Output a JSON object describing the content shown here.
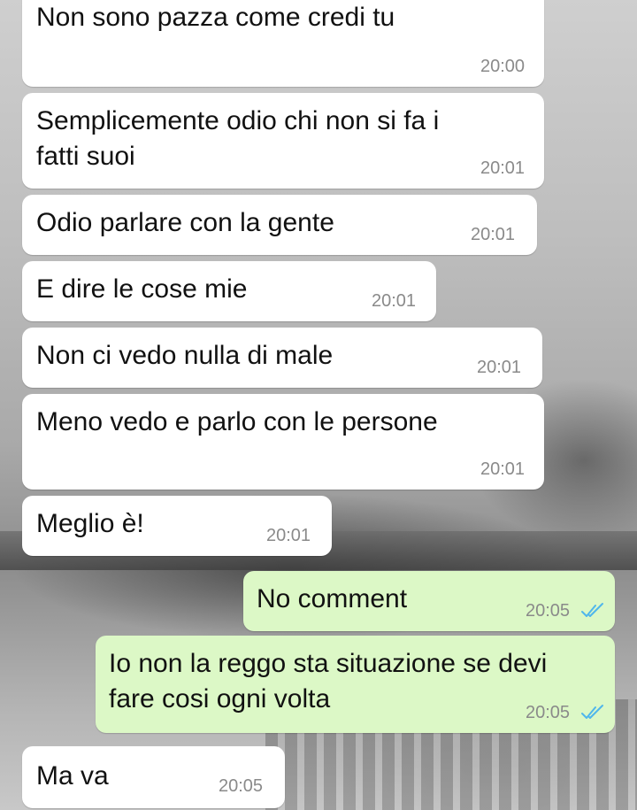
{
  "colors": {
    "incoming_bubble": "#ffffff",
    "outgoing_bubble": "#dcf8c6",
    "timestamp": "#8a8a8a",
    "read_ticks": "#4fb6ec"
  },
  "wallpaper": {
    "icon": "photo-wallpaper-icon"
  },
  "messages": [
    {
      "direction": "incoming",
      "lines": [
        "Non sono pazza come credi tu"
      ],
      "time": "20:00"
    },
    {
      "direction": "incoming",
      "lines": [
        "Semplicemente odio chi non si fa i",
        "fatti suoi"
      ],
      "time": "20:01"
    },
    {
      "direction": "incoming",
      "lines": [
        "Odio parlare con la gente"
      ],
      "time": "20:01"
    },
    {
      "direction": "incoming",
      "lines": [
        "E dire le cose mie"
      ],
      "time": "20:01"
    },
    {
      "direction": "incoming",
      "lines": [
        "Non ci vedo nulla di male"
      ],
      "time": "20:01"
    },
    {
      "direction": "incoming",
      "lines": [
        "Meno vedo e parlo con le persone"
      ],
      "time": "20:01"
    },
    {
      "direction": "incoming",
      "lines": [
        "Meglio è!"
      ],
      "time": "20:01"
    },
    {
      "direction": "outgoing",
      "lines": [
        "No comment"
      ],
      "time": "20:05",
      "status_icon": "double-check-read-icon"
    },
    {
      "direction": "outgoing",
      "lines": [
        "Io non la reggo sta situazione se devi",
        "fare cosi ogni volta"
      ],
      "time": "20:05",
      "status_icon": "double-check-read-icon"
    },
    {
      "direction": "incoming",
      "lines": [
        "Ma va"
      ],
      "time": "20:05"
    }
  ]
}
